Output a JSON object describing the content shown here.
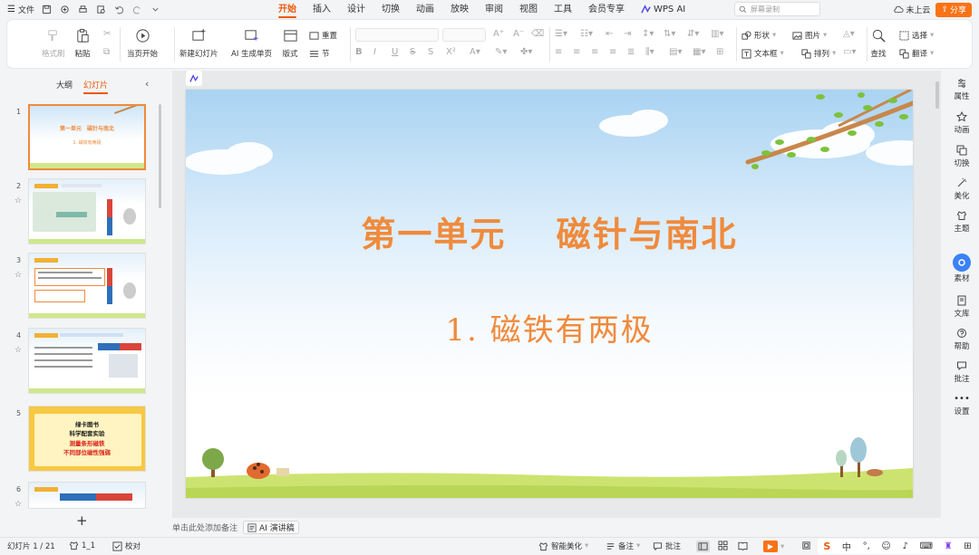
{
  "topbar": {
    "menu_label": "文件",
    "tabs": [
      "开始",
      "插入",
      "设计",
      "切换",
      "动画",
      "放映",
      "审阅",
      "视图",
      "工具",
      "会员专享"
    ],
    "active_tab": "开始",
    "wps_ai": "WPS AI",
    "search_placeholder": "屏幕录制",
    "cloud_label": "未上云",
    "share_label": "分享"
  },
  "ribbon": {
    "format_painter": "格式刷",
    "paste": "粘贴",
    "play_from_current": "当页开始",
    "new_slide": "新建幻灯片",
    "ai_slide": "AI 生成单页",
    "layout": "版式",
    "reset": "重置",
    "section": "节",
    "shape": "形状",
    "image": "图片",
    "textbox": "文本框",
    "arrange": "排列",
    "find": "查找",
    "select": "选择",
    "translate": "翻译"
  },
  "left_panel": {
    "tab_outline": "大纲",
    "tab_slides": "幻灯片",
    "thumbnails": [
      {
        "num": "1",
        "title": "第一单元　磁针与南北",
        "sub": "1. 磁铁有两极"
      },
      {
        "num": "2"
      },
      {
        "num": "3"
      },
      {
        "num": "4"
      },
      {
        "num": "5",
        "line1": "绿卡图书",
        "line2": "科学配套实验",
        "line3": "测量条形磁铁",
        "line4": "不同部位磁性强弱"
      },
      {
        "num": "6"
      }
    ]
  },
  "slide": {
    "title": "第一单元　 磁针与南北",
    "subtitle": "1. 磁铁有两极"
  },
  "notes": {
    "placeholder": "单击此处添加备注",
    "ai_speech": "AI 演讲稿"
  },
  "right_panel": {
    "items": [
      "属性",
      "动画",
      "切换",
      "美化",
      "主题",
      "素材",
      "文库",
      "帮助",
      "批注",
      "设置"
    ]
  },
  "statusbar": {
    "slide_count": "幻灯片 1 / 21",
    "theme": "1_1",
    "proofread": "校对",
    "smart_beautify": "智能美化",
    "notes": "备注",
    "comments": "批注",
    "ime_text": "中"
  },
  "colors": {
    "accent": "#e8590c",
    "title_orange": "#f08a3c",
    "share_bg": "#f97316"
  }
}
